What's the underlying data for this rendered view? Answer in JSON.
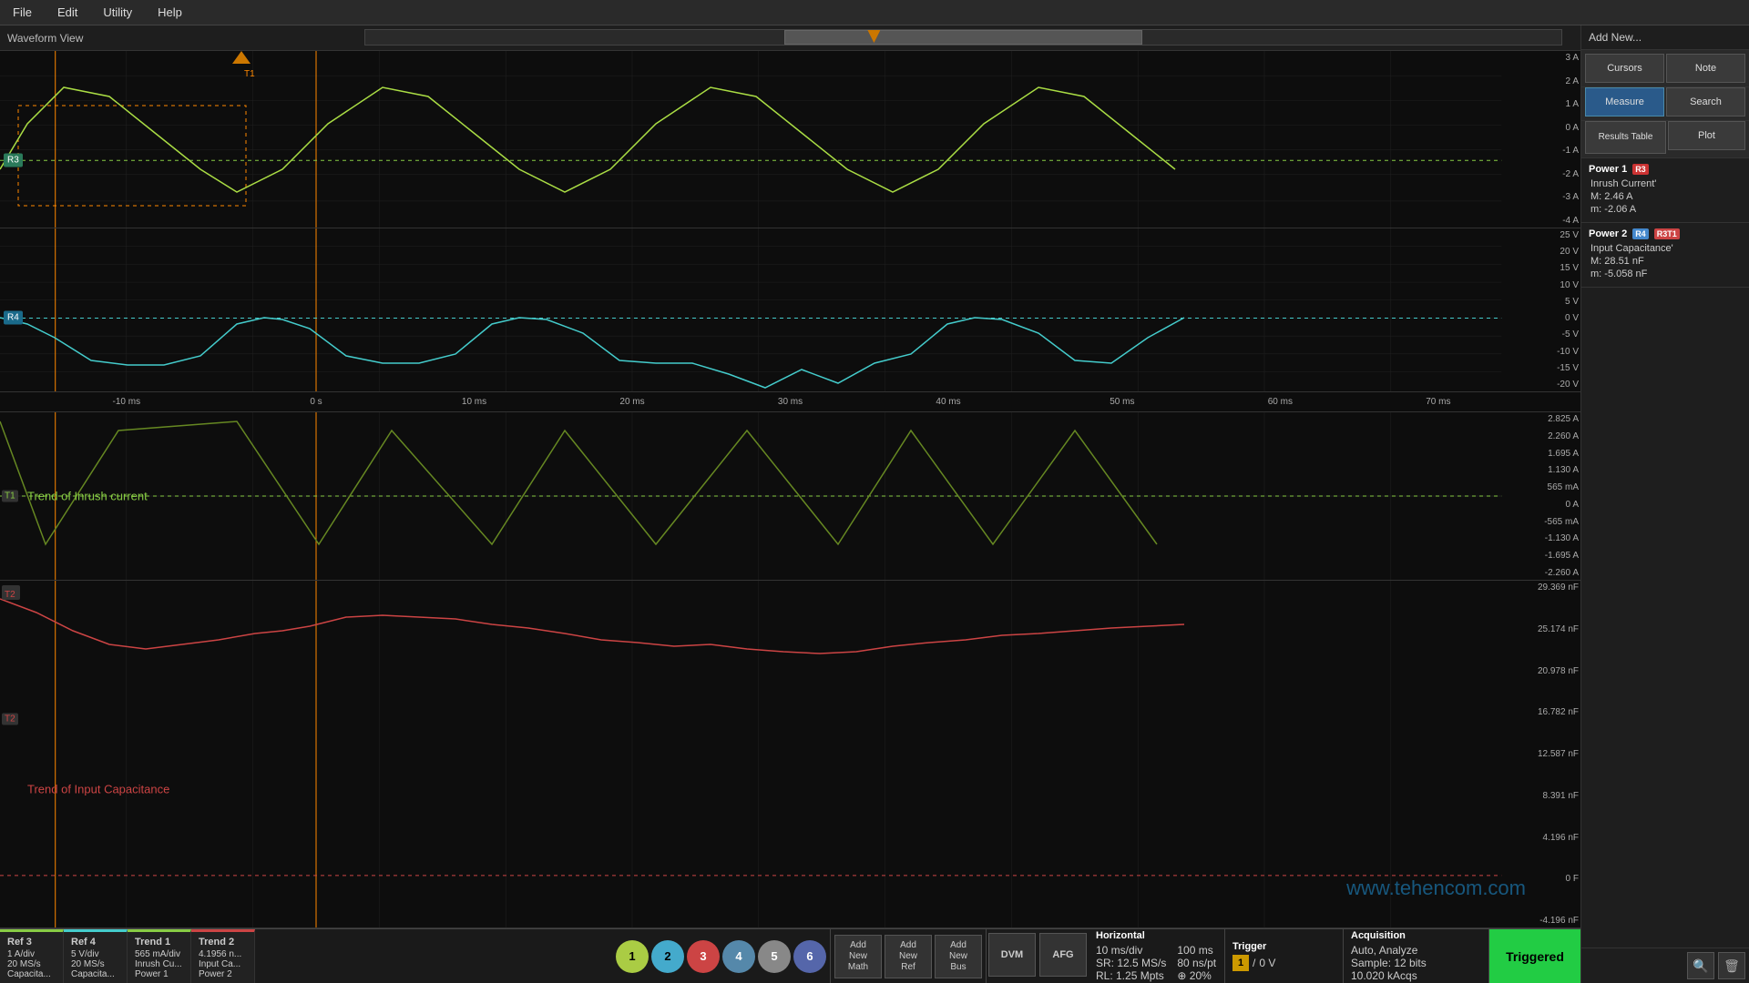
{
  "menubar": {
    "items": [
      "File",
      "Edit",
      "Utility",
      "Help"
    ]
  },
  "waveform_view": {
    "title": "Waveform View"
  },
  "right_panel": {
    "buttons": {
      "cursors": "Cursors",
      "note": "Note",
      "measure": "Measure",
      "search": "Search",
      "results_table": "Results Table",
      "plot": "Plot"
    }
  },
  "power1": {
    "title": "Power 1",
    "badge": "R3",
    "measurement": "Inrush Current'",
    "M_value": "M:  2.46 A",
    "m_value": "m: -2.06 A"
  },
  "power2": {
    "title": "Power 2",
    "badge": "R4",
    "badge2": "R3T1",
    "measurement": "Input Capacitance'",
    "M_value": "M:  28.51 nF",
    "m_value": "m: -5.058 nF"
  },
  "channels": {
    "ref3_label": "R3",
    "ref4_label": "R4",
    "t1_label": "T1",
    "t2_label": "T2",
    "trend_inrush": "Trend of Inrush current",
    "trend_capacitance": "Trend of Input Capacitance"
  },
  "y_axis_top": {
    "labels": [
      "3 A",
      "2 A",
      "1 A",
      "0 A",
      "-1 A",
      "-2 A",
      "-3 A",
      "-4 A"
    ]
  },
  "y_axis_middle": {
    "labels": [
      "25 V",
      "20 V",
      "15 V",
      "10 V",
      "5 V",
      "0 V",
      "-5 V",
      "-10 V",
      "-15 V",
      "-20 V"
    ]
  },
  "y_axis_trend1": {
    "labels": [
      "2.825 A",
      "2.260 A",
      "1.695 A",
      "1.130 A",
      "565 mA",
      "0 A",
      "-565 mA",
      "-1.130 A",
      "-1.695 A",
      "-2.260 A"
    ]
  },
  "y_axis_trend2": {
    "labels": [
      "29.369 nF",
      "25.174 nF",
      "20.978 nF",
      "16.782 nF",
      "12.587 nF",
      "8.391 nF",
      "4.196 nF",
      "0 F",
      "-4.196 nF"
    ]
  },
  "time_labels": [
    "-10 ms",
    "0 s",
    "10 ms",
    "20 ms",
    "30 ms",
    "40 ms",
    "50 ms",
    "60 ms",
    "70 ms"
  ],
  "bottom_tabs": [
    {
      "name": "Ref 3",
      "class": "tab-ref3",
      "line1": "1 A/div",
      "line2": "20 MS/s",
      "line3": "Capacita..."
    },
    {
      "name": "Ref 4",
      "class": "tab-ref4",
      "line1": "5 V/div",
      "line2": "20 MS/s",
      "line3": "Capacita..."
    },
    {
      "name": "Trend 1",
      "class": "tab-trend1",
      "line1": "565 mA/div",
      "line2": "Inrush Cu...",
      "line3": "Power 1"
    },
    {
      "name": "Trend 2",
      "class": "tab-trend2",
      "line1": "4.1956 n...",
      "line2": "Input Ca...",
      "line3": "Power 2"
    }
  ],
  "channel_buttons": [
    "1",
    "2",
    "3",
    "4",
    "5",
    "6"
  ],
  "add_buttons": [
    {
      "line1": "Add",
      "line2": "New",
      "line3": "Math"
    },
    {
      "line1": "Add",
      "line2": "New",
      "line3": "Ref"
    },
    {
      "line1": "Add",
      "line2": "New",
      "line3": "Bus"
    }
  ],
  "util_buttons": [
    "DVM",
    "AFG"
  ],
  "horizontal": {
    "title": "Horizontal",
    "line1": "10 ms/div",
    "line2": "SR: 12.5 MS/s",
    "line3": "RL: 1.25 Mpts",
    "col2_line1": "100 ms",
    "col2_line2": "80 ns/pt",
    "col2_line3": "⊕ 20%"
  },
  "trigger": {
    "title": "Trigger",
    "ch_indicator": "1",
    "slope": "/",
    "level": "0 V"
  },
  "acquisition": {
    "title": "Acquisition",
    "mode": "Auto,  Analyze",
    "sample": "Sample: 12 bits",
    "acqs": "10.020 kAcqs"
  },
  "triggered_btn": "Triggered",
  "watermark": "www.tehencom.com",
  "icons": {
    "zoom_in": "🔍",
    "trash": "🗑"
  }
}
